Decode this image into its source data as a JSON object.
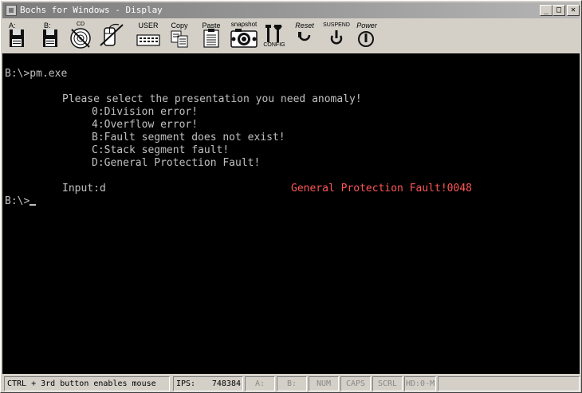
{
  "window": {
    "title": "Bochs for Windows - Display",
    "controls": {
      "minimize": "_",
      "maximize": "□",
      "close": "✕"
    }
  },
  "toolbar": {
    "buttons": [
      {
        "id": "floppy-a",
        "label": "A:",
        "icon": "floppy-disk-icon"
      },
      {
        "id": "floppy-b",
        "label": "B:",
        "icon": "floppy-disk-icon"
      },
      {
        "id": "cdrom",
        "label": "CD",
        "icon": "cdrom-icon"
      },
      {
        "id": "mouse",
        "label": "",
        "icon": "mouse-icon"
      },
      {
        "id": "user",
        "label": "USER",
        "icon": "keyboard-icon"
      },
      {
        "id": "copy",
        "label": "Copy",
        "icon": "copy-icon"
      },
      {
        "id": "paste",
        "label": "Paste",
        "icon": "paste-icon"
      },
      {
        "id": "snapshot",
        "label": "snapshot",
        "icon": "camera-icon"
      },
      {
        "id": "config",
        "label": "CONFIG",
        "icon": "config-icon"
      },
      {
        "id": "reset",
        "label": "Reset",
        "icon": "reset-icon"
      },
      {
        "id": "suspend",
        "label": "SUSPEND",
        "icon": "suspend-icon"
      },
      {
        "id": "power",
        "label": "Power",
        "icon": "power-icon"
      }
    ]
  },
  "console": {
    "lines": [
      "B:\\>pm.exe",
      "Please select the presentation you need anomaly!",
      "0:Division error!",
      "4:Overflow error!",
      "B:Fault segment does not exist!",
      "C:Stack segment fault!",
      "D:General Protection Fault!",
      "Input:d",
      "B:\\>"
    ],
    "error_message": "General Protection Fault!0048",
    "colors": {
      "foreground": "#c0c0c0",
      "background": "#000000",
      "error": "#ff5555"
    }
  },
  "statusbar": {
    "mouse_hint": "CTRL + 3rd button enables mouse",
    "ips_label": "IPS:",
    "ips_value": "748384",
    "drive_a": "A:",
    "drive_b": "B:",
    "num": "NUM",
    "caps": "CAPS",
    "scrl": "SCRL",
    "hd": "HD:0-M"
  }
}
